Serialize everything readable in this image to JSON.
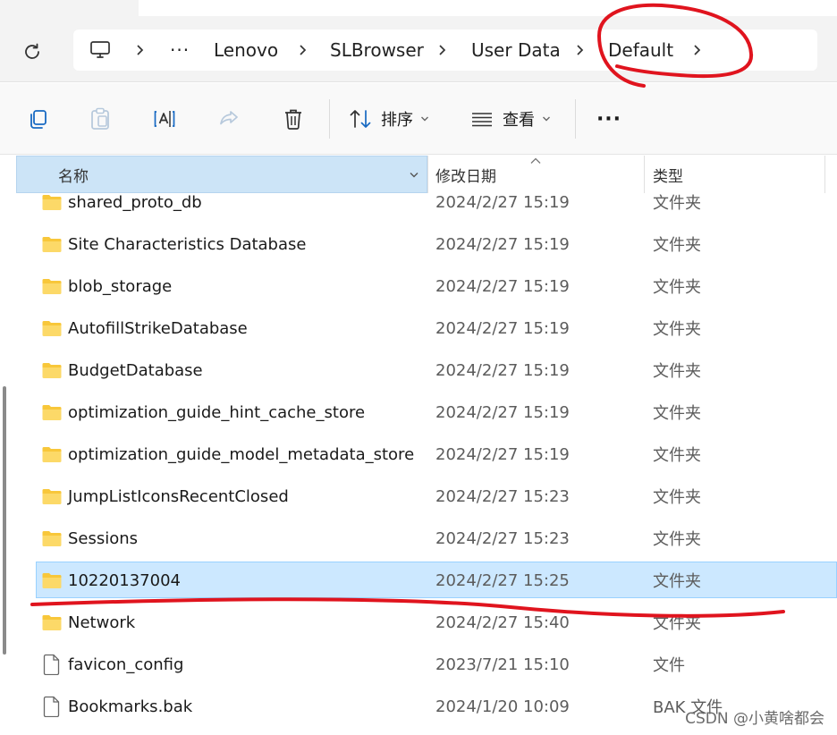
{
  "breadcrumb": {
    "items": [
      "Lenovo",
      "SLBrowser",
      "User Data",
      "Default"
    ],
    "overflow": "···"
  },
  "toolbar": {
    "sort_label": "排序",
    "view_label": "查看",
    "more_label": "···"
  },
  "columns": {
    "name": "名称",
    "modified": "修改日期",
    "type": "类型"
  },
  "files": [
    {
      "name": "shared_proto_db",
      "modified": "2024/2/27 15:19",
      "type": "文件夹",
      "icon": "folder-icon"
    },
    {
      "name": "Site Characteristics Database",
      "modified": "2024/2/27 15:19",
      "type": "文件夹",
      "icon": "folder-icon"
    },
    {
      "name": "blob_storage",
      "modified": "2024/2/27 15:19",
      "type": "文件夹",
      "icon": "folder-icon"
    },
    {
      "name": "AutofillStrikeDatabase",
      "modified": "2024/2/27 15:19",
      "type": "文件夹",
      "icon": "folder-icon"
    },
    {
      "name": "BudgetDatabase",
      "modified": "2024/2/27 15:19",
      "type": "文件夹",
      "icon": "folder-icon"
    },
    {
      "name": "optimization_guide_hint_cache_store",
      "modified": "2024/2/27 15:19",
      "type": "文件夹",
      "icon": "folder-icon"
    },
    {
      "name": "optimization_guide_model_metadata_store",
      "modified": "2024/2/27 15:19",
      "type": "文件夹",
      "icon": "folder-icon"
    },
    {
      "name": "JumpListIconsRecentClosed",
      "modified": "2024/2/27 15:23",
      "type": "文件夹",
      "icon": "folder-icon"
    },
    {
      "name": "Sessions",
      "modified": "2024/2/27 15:23",
      "type": "文件夹",
      "icon": "folder-icon"
    },
    {
      "name": "10220137004",
      "modified": "2024/2/27 15:25",
      "type": "文件夹",
      "icon": "folder-icon",
      "selected": true
    },
    {
      "name": "Network",
      "modified": "2024/2/27 15:40",
      "type": "文件夹",
      "icon": "folder-icon"
    },
    {
      "name": "favicon_config",
      "modified": "2023/7/21 15:10",
      "type": "文件",
      "icon": "file-icon"
    },
    {
      "name": "Bookmarks.bak",
      "modified": "2024/1/20 10:09",
      "type": "BAK 文件",
      "icon": "file-icon"
    }
  ],
  "watermark": "CSDN @小黄啥都会",
  "colors": {
    "selection_bg": "#cce8ff",
    "header_sort_bg": "#cce4f7",
    "folder_yellow": "#f8c73a",
    "annotation_red": "#e0141e"
  }
}
